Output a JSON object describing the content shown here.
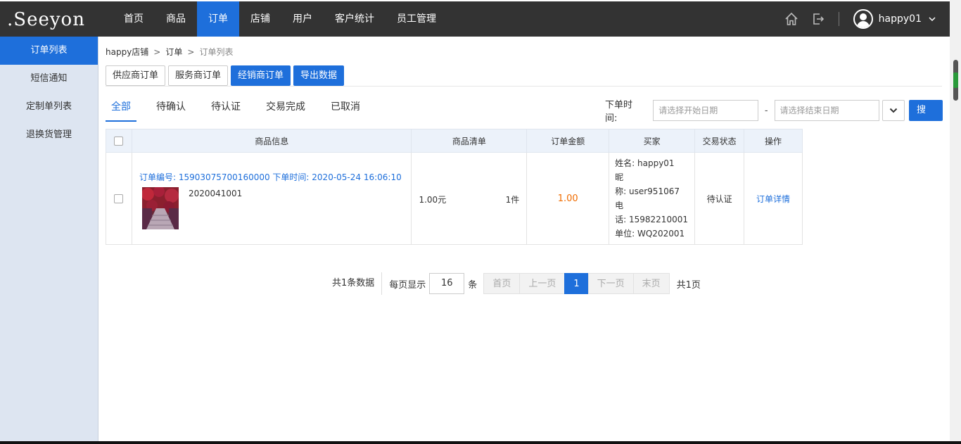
{
  "brand": {
    "logo_text": ".Seeyon"
  },
  "nav": {
    "items": [
      {
        "label": "首页",
        "active": false
      },
      {
        "label": "商品",
        "active": false
      },
      {
        "label": "订单",
        "active": true
      },
      {
        "label": "店铺",
        "active": false
      },
      {
        "label": "用户",
        "active": false
      },
      {
        "label": "客户统计",
        "active": false
      },
      {
        "label": "员工管理",
        "active": false
      }
    ],
    "user": {
      "name": "happy01",
      "caret": "⌄"
    }
  },
  "sidebar": {
    "items": [
      {
        "label": "订单列表",
        "active": true
      },
      {
        "label": "短信通知",
        "active": false
      },
      {
        "label": "定制单列表",
        "active": false
      },
      {
        "label": "退换货管理",
        "active": false
      }
    ]
  },
  "breadcrumb": {
    "items": [
      "happy店铺",
      "订单",
      "订单列表"
    ],
    "separator": ">"
  },
  "order_types": [
    {
      "label": "供应商订单",
      "primary": false
    },
    {
      "label": "服务商订单",
      "primary": false
    },
    {
      "label": "经销商订单",
      "primary": true
    },
    {
      "label": "导出数据",
      "primary": true
    }
  ],
  "tabs": [
    {
      "label": "全部",
      "active": true
    },
    {
      "label": "待确认",
      "active": false
    },
    {
      "label": "待认证",
      "active": false
    },
    {
      "label": "交易完成",
      "active": false
    },
    {
      "label": "已取消",
      "active": false
    }
  ],
  "filter": {
    "label": "下单时间:",
    "start_placeholder": "请选择开始日期",
    "end_placeholder": "请选择结束日期",
    "dash": "-",
    "search_label": "搜索"
  },
  "table": {
    "headers": [
      "商品信息",
      "商品清单",
      "订单金额",
      "买家",
      "交易状态",
      "操作"
    ],
    "rows": [
      {
        "order_line": "订单编号: 15903075700160000 下单时间: 2020-05-24 16:06:10",
        "goods_code": "2020041001",
        "price": "1.00元",
        "qty": "1件",
        "amount": "1.00",
        "buyer": [
          "姓名: happy01",
          "昵",
          "称: user951067",
          "电",
          "话: 15982210001",
          "单位: WQ202001"
        ],
        "status": "待认证",
        "action": "订单详情"
      }
    ]
  },
  "pager": {
    "total": "共1条数据",
    "size_label": "每页显示",
    "size_value": "16",
    "size_unit": "条",
    "first": "首页",
    "prev": "上一页",
    "current": "1",
    "next": "下一页",
    "last": "末页",
    "pages": "共1页"
  },
  "colors": {
    "primary": "#1e6fdb",
    "topbar": "#333333",
    "sidebar": "#dde5f1",
    "amount": "#f06c00"
  }
}
